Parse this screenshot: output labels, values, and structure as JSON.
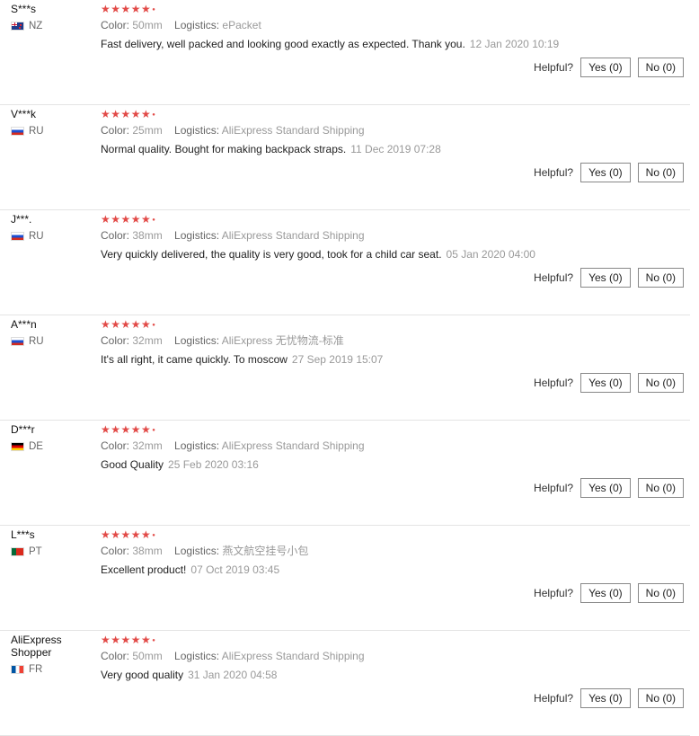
{
  "helpful_label": "Helpful?",
  "colors": {
    "stars": "#e24a47",
    "muted": "#999999"
  },
  "reviews": [
    {
      "user": "S***s",
      "country": "NZ",
      "flag": "nz",
      "stars": "★★★★★",
      "color_label": "Color:",
      "color": "50mm",
      "logistics_label": "Logistics:",
      "logistics": "ePacket",
      "text": "Fast delivery, well packed and looking good exactly as expected. Thank you.",
      "date": "12 Jan 2020 10:19",
      "yes": "Yes (0)",
      "no": "No (0)"
    },
    {
      "user": "V***k",
      "country": "RU",
      "flag": "ru",
      "stars": "★★★★★",
      "color_label": "Color:",
      "color": "25mm",
      "logistics_label": "Logistics:",
      "logistics": "AliExpress Standard Shipping",
      "text": "Normal quality. Bought for making backpack straps.",
      "date": "11 Dec 2019 07:28",
      "yes": "Yes (0)",
      "no": "No (0)"
    },
    {
      "user": "J***.",
      "country": "RU",
      "flag": "ru",
      "stars": "★★★★★",
      "color_label": "Color:",
      "color": "38mm",
      "logistics_label": "Logistics:",
      "logistics": "AliExpress Standard Shipping",
      "text": "Very quickly delivered, the quality is very good, took for a child car seat.",
      "date": "05 Jan 2020 04:00",
      "yes": "Yes (0)",
      "no": "No (0)"
    },
    {
      "user": "A***n",
      "country": "RU",
      "flag": "ru",
      "stars": "★★★★★",
      "color_label": "Color:",
      "color": "32mm",
      "logistics_label": "Logistics:",
      "logistics": "AliExpress 无忧物流-标准",
      "text": "It's all right, it came quickly. To moscow",
      "date": "27 Sep 2019 15:07",
      "yes": "Yes (0)",
      "no": "No (0)"
    },
    {
      "user": "D***r",
      "country": "DE",
      "flag": "de",
      "stars": "★★★★★",
      "color_label": "Color:",
      "color": "32mm",
      "logistics_label": "Logistics:",
      "logistics": "AliExpress Standard Shipping",
      "text": "Good Quality",
      "date": "25 Feb 2020 03:16",
      "yes": "Yes (0)",
      "no": "No (0)"
    },
    {
      "user": "L***s",
      "country": "PT",
      "flag": "pt",
      "stars": "★★★★★",
      "color_label": "Color:",
      "color": "38mm",
      "logistics_label": "Logistics:",
      "logistics": "燕文航空挂号小包",
      "text": "Excellent product!",
      "date": "07 Oct 2019 03:45",
      "yes": "Yes (0)",
      "no": "No (0)"
    },
    {
      "user": "AliExpress Shopper",
      "country": "FR",
      "flag": "fr",
      "stars": "★★★★★",
      "color_label": "Color:",
      "color": "50mm",
      "logistics_label": "Logistics:",
      "logistics": "AliExpress Standard Shipping",
      "text": "Very good quality",
      "date": "31 Jan 2020 04:58",
      "yes": "Yes (0)",
      "no": "No (0)"
    }
  ]
}
